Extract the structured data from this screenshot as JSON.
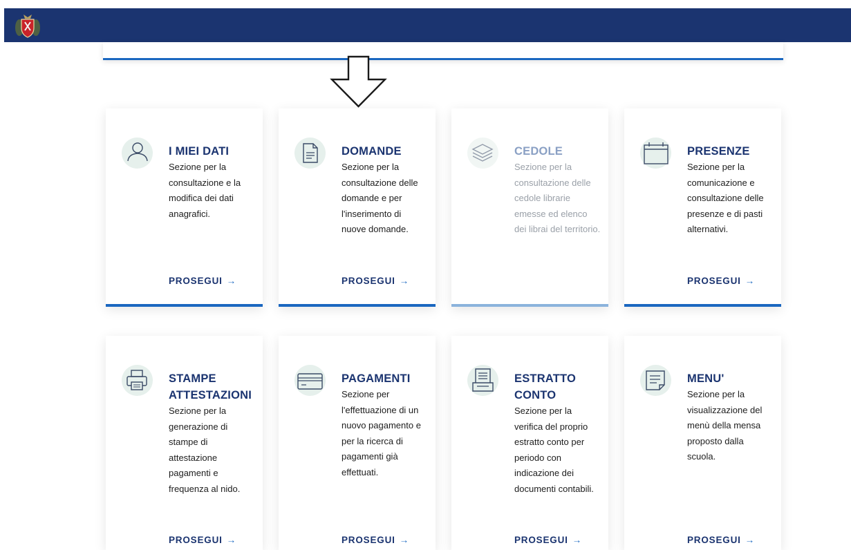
{
  "header": {
    "logo_icon": "coat-of-arms-icon",
    "brand_color": "#1b3470",
    "accent_color": "#1a67c0"
  },
  "cards": [
    {
      "title": "I MIEI DATI",
      "description": "Sezione per la consultazione e la modifica dei dati anagrafici.",
      "action": "PROSEGUI",
      "action_arrow": "→",
      "icon": "user-icon",
      "enabled": true
    },
    {
      "title": "DOMANDE",
      "description": "Sezione per la consultazione delle domande e per l'inserimento di nuove domande.",
      "action": "PROSEGUI",
      "action_arrow": "→",
      "icon": "document-icon",
      "enabled": true
    },
    {
      "title": "CEDOLE",
      "description": "Sezione per la consultazione delle cedole librarie emesse ed elenco dei librai del territorio.",
      "icon": "layers-icon",
      "enabled": false
    },
    {
      "title": "PRESENZE",
      "description": "Sezione per la comunicazione e consultazione delle presenze e di pasti alternativi.",
      "action": "PROSEGUI",
      "action_arrow": "→",
      "icon": "calendar-icon",
      "enabled": true
    },
    {
      "title": "STAMPE ATTESTAZIONI",
      "description": "Sezione per la generazione di stampe di attestazione pagamenti e frequenza al nido.",
      "action": "PROSEGUI",
      "action_arrow": "→",
      "icon": "printer-icon",
      "enabled": true
    },
    {
      "title": "PAGAMENTI",
      "description": "Sezione per l'effettuazione di un nuovo pagamento e per la ricerca di pagamenti già effettuati.",
      "action": "PROSEGUI",
      "action_arrow": "→",
      "icon": "credit-card-icon",
      "enabled": true
    },
    {
      "title": "ESTRATTO CONTO",
      "description": "Sezione per la verifica del proprio estratto conto per periodo con indicazione dei documenti contabili.",
      "action": "PROSEGUI",
      "action_arrow": "→",
      "icon": "receipt-icon",
      "enabled": true
    },
    {
      "title": "MENU'",
      "description": "Sezione per la visualizzazione del menù della mensa proposto dalla scuola.",
      "action": "PROSEGUI",
      "action_arrow": "→",
      "icon": "note-icon",
      "enabled": true
    }
  ]
}
